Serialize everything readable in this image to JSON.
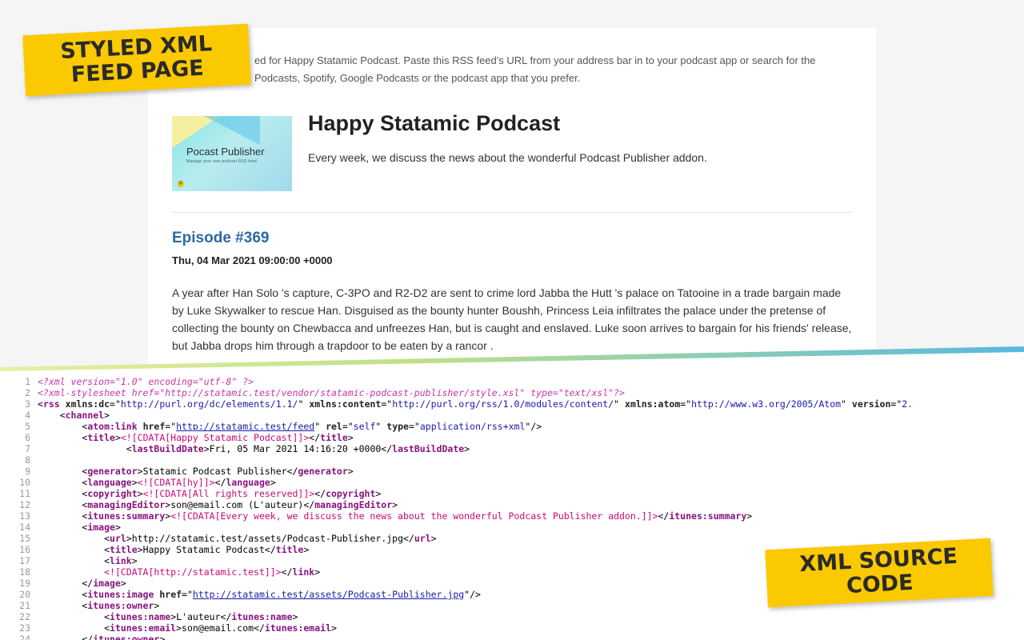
{
  "labels": {
    "top_line1": "STYLED XML",
    "top_line2": "FEED PAGE",
    "bottom_line1": "XML SOURCE",
    "bottom_line2": "CODE"
  },
  "feed_page": {
    "intro": "ed for Happy Statamic Podcast. Paste this RSS feed's URL from your address bar in to your podcast app or search for the",
    "intro_line2": "Podcasts, Spotify, Google Podcasts or the podcast app that you prefer.",
    "cover": {
      "title": "Pocast Publisher",
      "subtitle": "Manage your own podcast RSS feed",
      "badge": "P"
    },
    "podcast_title": "Happy Statamic Podcast",
    "podcast_description": "Every week, we discuss the news about the wonderful Podcast Publisher addon.",
    "episode": {
      "title": "Episode #369",
      "date": "Thu, 04 Mar 2021 09:00:00 +0000",
      "description": "A year after Han Solo 's capture, C-3PO and R2-D2 are sent to crime lord Jabba the Hutt 's palace on Tatooine in a trade bargain made by Luke Skywalker to rescue Han. Disguised as the bounty hunter Boushh, Princess Leia infiltrates the palace under the pretense of collecting the bounty on Chewbacca and unfreezes Han, but is caught and enslaved. Luke soon arrives to bargain for his friends' release, but Jabba drops him through a trapdoor to be eaten by a rancor ."
    }
  },
  "source": {
    "line_numbers": [
      "1",
      "2",
      "3",
      "4",
      "5",
      "6",
      "7",
      "8",
      "9",
      "10",
      "11",
      "12",
      "13",
      "14",
      "15",
      "16",
      "17",
      "18",
      "19",
      "20",
      "21",
      "22",
      "23",
      "24"
    ],
    "l1": "<?xml version=\"1.0\" encoding=\"utf-8\" ?>",
    "l2": "<?xml-stylesheet href=\"http://statamic.test/vendor/statamic-podcast-publisher/style.xsl\" type=\"text/xsl\"?>",
    "l3": {
      "tag": "rss",
      "a1": "xmlns:dc",
      "v1": "http://purl.org/dc/elements/1.1/",
      "a2": "xmlns:content",
      "v2": "http://purl.org/rss/1.0/modules/content/",
      "a3": "xmlns:atom",
      "v3": "http://www.w3.org/2005/Atom",
      "a4": "version",
      "v4": "2."
    },
    "l4": "channel",
    "l5": {
      "tag": "atom:link",
      "a1": "href",
      "v1": "http://statamic.test/feed",
      "a2": "rel",
      "v2": "self",
      "a3": "type",
      "v3": "application/rss+xml"
    },
    "l6": {
      "tag": "title",
      "cdata": "<![CDATA[Happy Statamic Podcast]]>"
    },
    "l7": {
      "tag": "lastBuildDate",
      "text": "Fri, 05 Mar 2021 14:16:20 +0000"
    },
    "l9": {
      "tag": "generator",
      "text": "Statamic Podcast Publisher"
    },
    "l10": {
      "tag": "language",
      "cdata": "<![CDATA[hy]]>"
    },
    "l11": {
      "tag": "copyright",
      "cdata": "<![CDATA[All rights reserved]]>"
    },
    "l12": {
      "tag": "managingEditor",
      "text": "son@email.com (L'auteur)"
    },
    "l13": {
      "tag": "itunes:summary",
      "cdata": "<![CDATA[Every week, we discuss the news about the wonderful Podcast Publisher addon.]]>"
    },
    "l14": "image",
    "l15": {
      "tag": "url",
      "text": "http://statamic.test/assets/Podcast-Publisher.jpg"
    },
    "l16": {
      "tag": "title",
      "text": "Happy Statamic Podcast"
    },
    "l17": "link",
    "l18": {
      "tag": "link",
      "cdata": "<![CDATA[http://statamic.test]]>"
    },
    "l19": "image",
    "l20": {
      "tag": "itunes:image",
      "a1": "href",
      "v1": "http://statamic.test/assets/Podcast-Publisher.jpg"
    },
    "l21": "itunes:owner",
    "l22": {
      "tag": "itunes:name",
      "text": "L'auteur"
    },
    "l23": {
      "tag": "itunes:email",
      "text": "son@email.com"
    },
    "l24": "itunes:owner"
  },
  "colors": {
    "label_yellow": "#fbc900",
    "episode_link": "#2b6aa6",
    "xml_tag": "#881280",
    "xml_value": "#1a1aa6",
    "xml_cdata": "#c80a7a",
    "xml_pi": "#c837ab",
    "separator_green": "#c9e27a",
    "separator_blue": "#58b9e0"
  }
}
